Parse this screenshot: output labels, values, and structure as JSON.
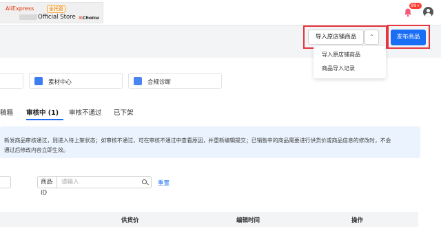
{
  "header": {
    "brand": "AliExpress",
    "brand_tag": "全托管",
    "store_name": "Official Store",
    "choice_prefix": "Choice",
    "notification_count": "99+"
  },
  "actions": {
    "import_button": "导入原店铺商品",
    "publish_button": "发布商品",
    "dropdown_items": [
      "导入原店铺商品",
      "商品导入记录"
    ]
  },
  "tools": [
    {
      "label": "素材中心",
      "icon": "image-icon"
    },
    {
      "label": "合规诊断",
      "icon": "diagnosis-icon"
    }
  ],
  "tabs": [
    {
      "label": "稿箱",
      "active": false
    },
    {
      "label": "审核中 (1)",
      "active": true
    },
    {
      "label": "审核不通过",
      "active": false
    },
    {
      "label": "已下架",
      "active": false
    }
  ],
  "notice": {
    "line1": "新发商品审核通过，则进入待上架状态；如审核不通过，可在审核不通过中查看原因，并重新编辑提交；已销售中的商品需要进行供货价或商品信息的修改时，不会",
    "line2": "通过后修改内容立即生效。"
  },
  "filter": {
    "select_value": "商品ID",
    "search_placeholder": "请输入",
    "reset_label": "重置"
  },
  "table": {
    "columns": [
      "供货价",
      "编辑时间",
      "操作"
    ]
  },
  "colors": {
    "primary": "#1a6ef5",
    "highlight_box": "#e5343c",
    "notice_bg": "#eaf3fe"
  }
}
